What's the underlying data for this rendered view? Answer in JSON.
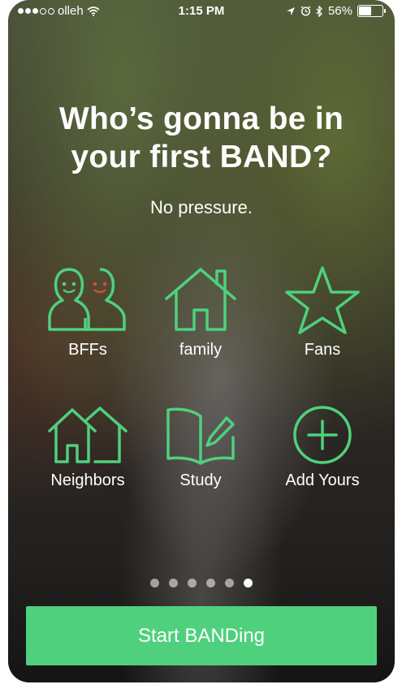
{
  "status_bar": {
    "carrier": "olleh",
    "time": "1:15 PM",
    "battery_text": "56%",
    "battery_level": 0.56
  },
  "headline": {
    "line1": "Who’s gonna be in",
    "line2": "your first BAND?"
  },
  "subheadline": "No pressure.",
  "options": [
    {
      "label": "BFFs",
      "icon": "friends-icon"
    },
    {
      "label": "family",
      "icon": "house-icon"
    },
    {
      "label": "Fans",
      "icon": "star-icon"
    },
    {
      "label": "Neighbors",
      "icon": "neighborhood-icon"
    },
    {
      "label": "Study",
      "icon": "book-pencil-icon"
    },
    {
      "label": "Add Yours",
      "icon": "plus-circle-icon"
    }
  ],
  "pager": {
    "total": 6,
    "active_index": 5
  },
  "cta": {
    "label": "Start BANDing"
  },
  "colors": {
    "accent": "#4fd07d",
    "text": "#ffffff"
  }
}
